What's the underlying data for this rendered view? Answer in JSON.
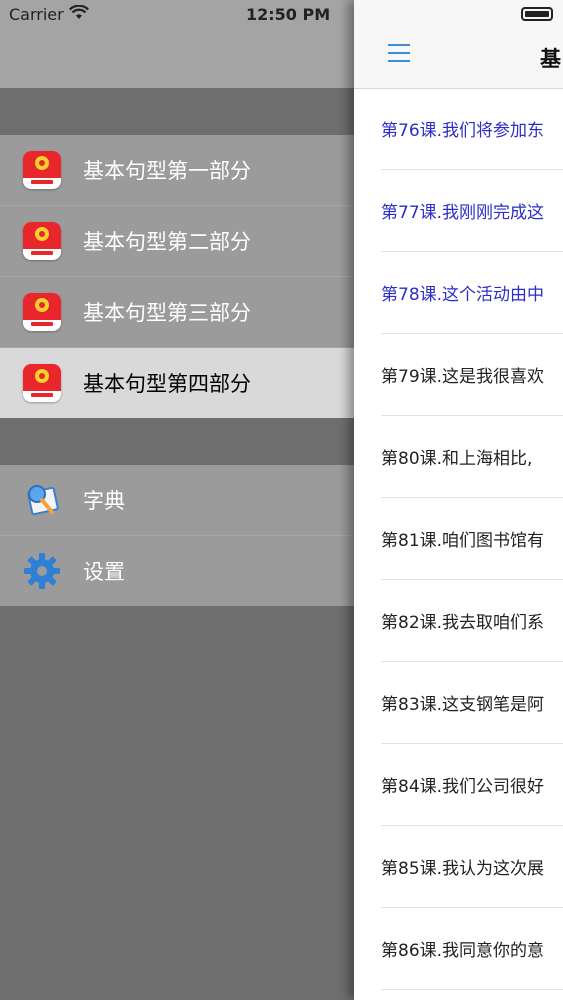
{
  "status": {
    "carrier": "Carrier",
    "time": "12:50 PM"
  },
  "sidebar": {
    "lessons": [
      {
        "label": "基本句型第一部分",
        "icon": "book-icon",
        "selected": false
      },
      {
        "label": "基本句型第二部分",
        "icon": "book-icon",
        "selected": false
      },
      {
        "label": "基本句型第三部分",
        "icon": "book-icon",
        "selected": false
      },
      {
        "label": "基本句型第四部分",
        "icon": "book-icon",
        "selected": true
      }
    ],
    "tools": [
      {
        "label": "字典",
        "icon": "dictionary-icon"
      },
      {
        "label": "设置",
        "icon": "gear-icon"
      }
    ]
  },
  "main": {
    "title": "基",
    "rows": [
      {
        "text": "第76课.我们将参加东",
        "color": "blue"
      },
      {
        "text": "第77课.我刚刚完成这",
        "color": "blue"
      },
      {
        "text": "第78课.这个活动由中",
        "color": "blue"
      },
      {
        "text": "第79课.这是我很喜欢",
        "color": "black"
      },
      {
        "text": "第80课.和上海相比,",
        "color": "black"
      },
      {
        "text": "第81课.咱们图书馆有",
        "color": "black"
      },
      {
        "text": "第82课.我去取咱们系",
        "color": "black"
      },
      {
        "text": "第83课.这支钢笔是阿",
        "color": "black"
      },
      {
        "text": "第84课.我们公司很好",
        "color": "black"
      },
      {
        "text": "第85课.我认为这次展",
        "color": "black"
      },
      {
        "text": "第86课.我同意你的意",
        "color": "black"
      }
    ]
  },
  "colors": {
    "accent": "#3b8fd9",
    "link_blue": "#2d2dc9",
    "selected_bg": "#d9d9d9"
  }
}
